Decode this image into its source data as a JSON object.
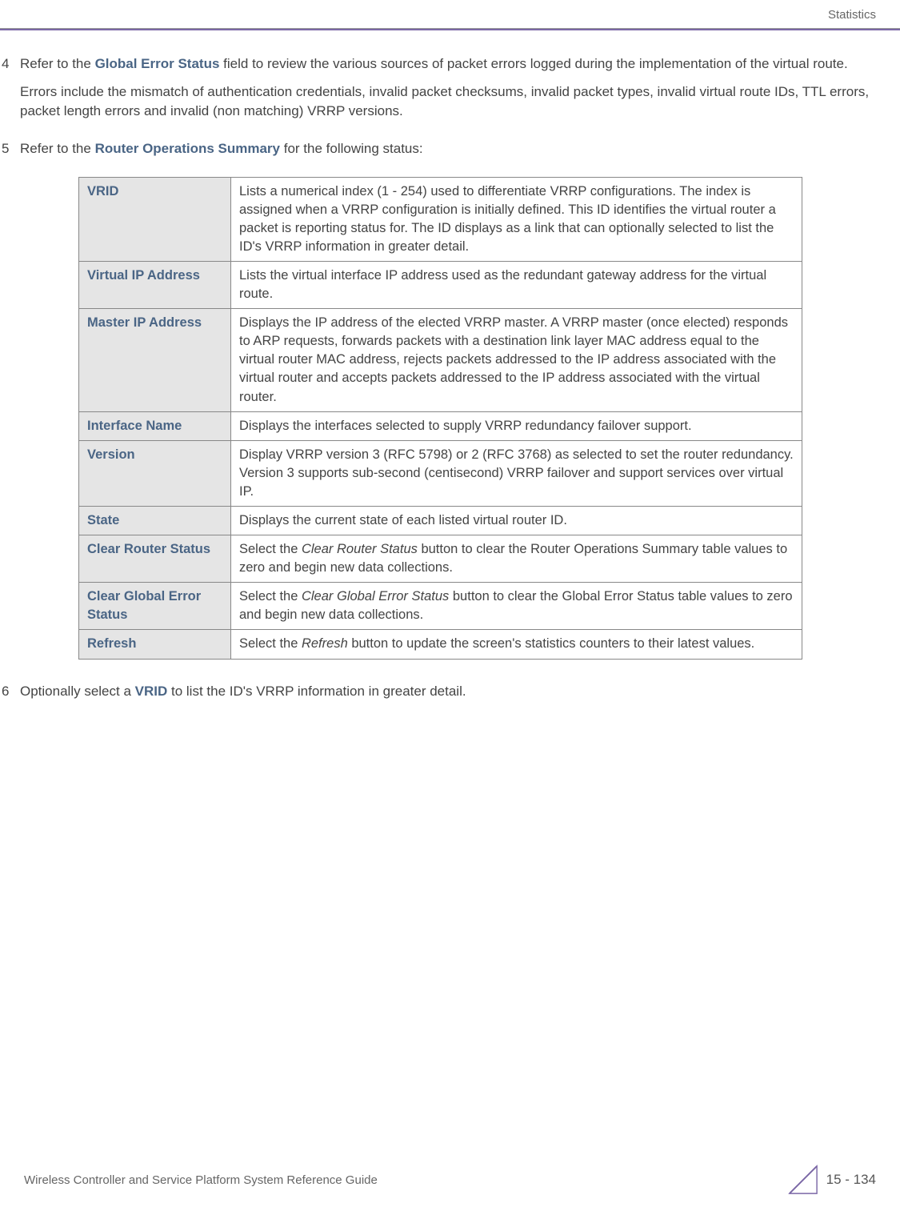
{
  "header": {
    "section": "Statistics"
  },
  "items": [
    {
      "number": "4",
      "paragraphs": [
        {
          "pre": "Refer to the ",
          "bold": "Global Error Status",
          "post": " field to review the various sources of packet errors logged during the implementation of the virtual route."
        },
        {
          "text": "Errors include the mismatch of authentication credentials, invalid packet checksums, invalid packet types, invalid virtual route IDs, TTL errors, packet length errors and invalid (non matching) VRRP versions."
        }
      ]
    },
    {
      "number": "5",
      "paragraphs": [
        {
          "pre": "Refer to the ",
          "bold": "Router Operations Summary",
          "post": " for the following status:"
        }
      ]
    }
  ],
  "table": [
    {
      "term": "VRID",
      "desc": "Lists a numerical index (1 - 254) used to differentiate VRRP configurations. The index is assigned when a VRRP configuration is initially defined. This ID identifies the virtual router a packet is reporting status for. The ID displays as a link that can optionally selected to list the ID's VRRP information in greater detail."
    },
    {
      "term": "Virtual IP Address",
      "desc": "Lists the virtual interface IP address used as the redundant gateway address for the virtual route."
    },
    {
      "term": "Master IP Address",
      "desc": "Displays the IP address of the elected VRRP master. A VRRP master (once elected) responds to ARP requests, forwards packets with a destination link layer MAC address equal to the virtual router MAC address, rejects packets addressed to the IP address associated with the virtual router and accepts packets addressed to the IP address associated with the virtual router."
    },
    {
      "term": "Interface Name",
      "desc": "Displays the interfaces selected to supply VRRP redundancy failover support."
    },
    {
      "term": "Version",
      "desc": "Display VRRP version 3 (RFC 5798) or 2 (RFC 3768) as selected to set the router redundancy. Version 3 supports sub-second (centisecond) VRRP failover and support services over virtual IP."
    },
    {
      "term": "State",
      "desc": "Displays the current state of each listed virtual router ID."
    },
    {
      "term": "Clear Router Status",
      "pre": "Select the ",
      "italic": "Clear Router Status",
      "post": " button to clear the Router Operations Summary table values to zero and begin new data collections."
    },
    {
      "term": "Clear Global Error Status",
      "pre": "Select the ",
      "italic": "Clear Global Error Status",
      "post": " button to clear the Global Error Status table values to zero and begin new data collections."
    },
    {
      "term": "Refresh",
      "pre": "Select the ",
      "italic": "Refresh",
      "post": " button to update the screen's statistics counters to their latest values."
    }
  ],
  "item6": {
    "number": "6",
    "pre": "Optionally select a ",
    "bold": "VRID",
    "post": " to list the ID's VRRP information in greater detail."
  },
  "footer": {
    "left": "Wireless Controller and Service Platform System Reference Guide",
    "page": "15 - 134"
  }
}
